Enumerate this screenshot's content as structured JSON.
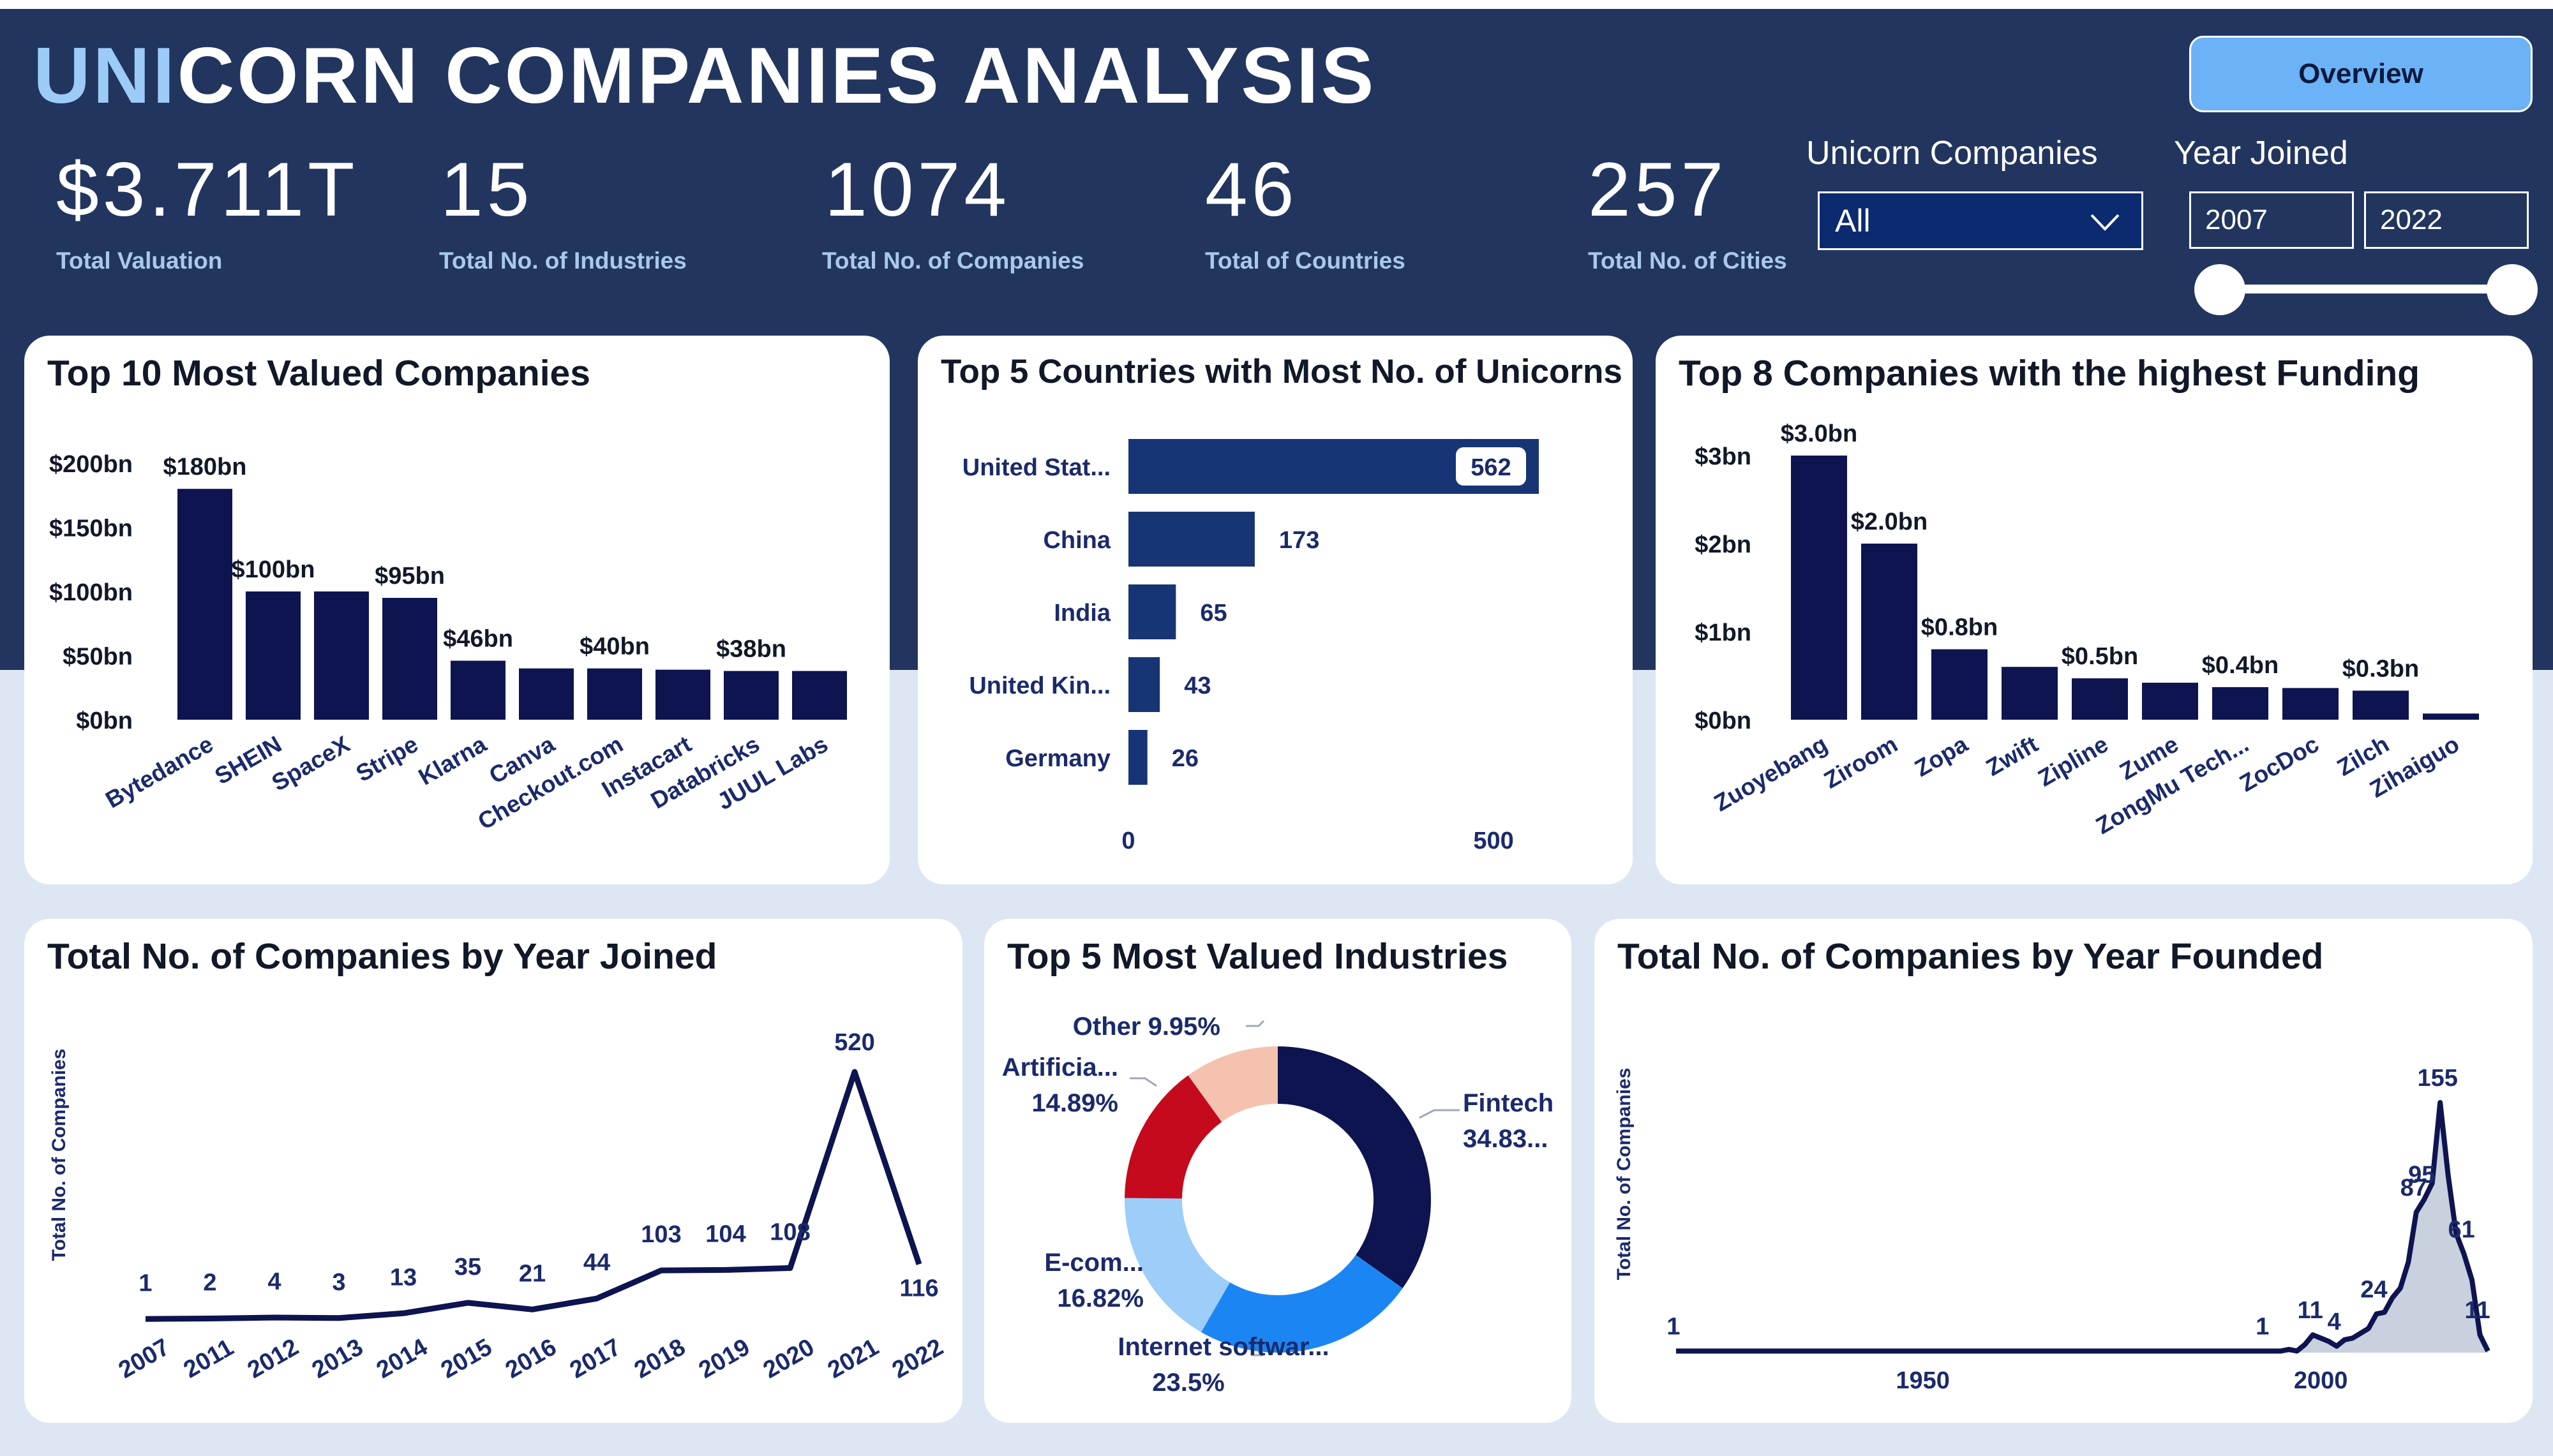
{
  "header": {
    "title_accent": "UNI",
    "title_rest": "CORN COMPANIES ANALYSIS",
    "overview_button": "Overview"
  },
  "kpis": [
    {
      "value": "$3.711T",
      "label": "Total Valuation"
    },
    {
      "value": "15",
      "label": "Total No. of Industries"
    },
    {
      "value": "1074",
      "label": "Total No. of Companies"
    },
    {
      "value": "46",
      "label": "Total of Countries"
    },
    {
      "value": "257",
      "label": "Total No. of Cities"
    }
  ],
  "filters": {
    "companies_title": "Unicorn Companies",
    "companies_selected": "All",
    "year_title": "Year Joined",
    "year_from": "2007",
    "year_to": "2022",
    "range_from_fraction": 0,
    "range_to_fraction": 1
  },
  "colors": {
    "header_bg": "#21355e",
    "page_bg": "#dce7f3",
    "navy": "#0d1450",
    "bar_blue": "#173574",
    "title_accent": "#9ccbf8",
    "button": "#6cb2f7"
  },
  "icons": [
    "chevron-down-icon"
  ],
  "chart_data": [
    {
      "id": "top_valued",
      "type": "bar",
      "title": "Top 10 Most Valued Companies",
      "categories": [
        "Bytedance",
        "SHEIN",
        "SpaceX",
        "Stripe",
        "Klarna",
        "Canva",
        "Checkout.com",
        "Instacart",
        "Databricks",
        "JUUL Labs"
      ],
      "values": [
        180,
        100,
        100,
        95,
        46,
        40,
        40,
        39,
        38,
        38
      ],
      "data_labels": [
        "$180bn",
        "$100bn",
        null,
        "$95bn",
        "$46bn",
        null,
        "$40bn",
        null,
        "$38bn",
        null
      ],
      "y_ticks": [
        "$0bn",
        "$50bn",
        "$100bn",
        "$150bn",
        "$200bn"
      ],
      "ylim": [
        0,
        200
      ],
      "color": "#0d1450"
    },
    {
      "id": "top_countries",
      "type": "bar",
      "orientation": "horizontal",
      "title": "Top 5 Countries with Most No. of Unicorns",
      "categories": [
        "United Stat...",
        "China",
        "India",
        "United Kin...",
        "Germany"
      ],
      "values": [
        562,
        173,
        65,
        43,
        26
      ],
      "data_labels": [
        "562",
        "173",
        "65",
        "43",
        "26"
      ],
      "x_ticks": [
        "0",
        "500"
      ],
      "xlim": [
        0,
        562
      ],
      "color": "#173574"
    },
    {
      "id": "top_funding",
      "type": "bar",
      "title": "Top 8 Companies with the highest Funding",
      "categories": [
        "Zuoyebang",
        "Ziroom",
        "Zopa",
        "Zwift",
        "Zipline",
        "Zume",
        "ZongMu Tech...",
        "ZocDoc",
        "Zilch",
        "Zihaiguo"
      ],
      "values": [
        3.0,
        2.0,
        0.8,
        0.6,
        0.47,
        0.42,
        0.37,
        0.36,
        0.33,
        0.07
      ],
      "data_labels": [
        "$3.0bn",
        "$2.0bn",
        "$0.8bn",
        null,
        "$0.5bn",
        null,
        "$0.4bn",
        null,
        "$0.3bn",
        null
      ],
      "y_ticks": [
        "$0bn",
        "$1bn",
        "$2bn",
        "$3bn"
      ],
      "ylim": [
        0,
        3.0
      ],
      "color": "#0d1450"
    },
    {
      "id": "year_joined",
      "type": "line",
      "title": "Total No. of Companies by Year Joined",
      "ylabel": "Total No. of Companies",
      "x": [
        "2007",
        "2011",
        "2012",
        "2013",
        "2014",
        "2015",
        "2016",
        "2017",
        "2018",
        "2019",
        "2020",
        "2021",
        "2022"
      ],
      "values": [
        1,
        2,
        4,
        3,
        13,
        35,
        21,
        44,
        103,
        104,
        108,
        520,
        116
      ],
      "data_labels": [
        "1",
        "2",
        "4",
        "3",
        "13",
        "35",
        "21",
        "44",
        "103",
        "104",
        "108",
        "520",
        "116"
      ],
      "ylim": [
        0,
        520
      ],
      "color": "#0d1450"
    },
    {
      "id": "industries",
      "type": "pie",
      "title": "Top 5 Most Valued Industries",
      "slices": [
        {
          "label": "Fintech",
          "pct_label": "34.83...",
          "value": 34.83,
          "color": "#0d1450"
        },
        {
          "label": "Internet softwar...",
          "pct_label": "23.5%",
          "value": 23.5,
          "color": "#1b86f3"
        },
        {
          "label": "E-com...",
          "pct_label": "16.82%",
          "value": 16.82,
          "color": "#9dcdf9"
        },
        {
          "label": "Artificia...",
          "pct_label": "14.89%",
          "value": 14.89,
          "color": "#c40a1c"
        },
        {
          "label": "Other",
          "pct_label": "9.95%",
          "value": 9.95,
          "color": "#f5c2b0"
        }
      ]
    },
    {
      "id": "year_founded",
      "type": "area",
      "title": "Total No. of Companies by Year Founded",
      "ylabel": "Total No. of Companies",
      "x": [
        1919,
        1960,
        1993,
        1994,
        1995,
        1996,
        1997,
        1998,
        1999,
        2000,
        2001,
        2002,
        2003,
        2004,
        2005,
        2006,
        2007,
        2008,
        2009,
        2010,
        2011,
        2012,
        2013,
        2014,
        2015,
        2016,
        2017,
        2018,
        2019,
        2020,
        2021
      ],
      "values": [
        1,
        1,
        1,
        1,
        1,
        2,
        1,
        5,
        11,
        9,
        7,
        4,
        8,
        9,
        12,
        15,
        24,
        25,
        34,
        40,
        56,
        87,
        95,
        105,
        155,
        110,
        74,
        61,
        45,
        11,
        1
      ],
      "labeled_points": [
        {
          "x": 1919,
          "label": "1"
        },
        {
          "x": 1993,
          "label": "1"
        },
        {
          "x": 1999,
          "label": "11"
        },
        {
          "x": 2002,
          "label": "4"
        },
        {
          "x": 2007,
          "label": "24"
        },
        {
          "x": 2012,
          "label": "87"
        },
        {
          "x": 2013,
          "label": "95"
        },
        {
          "x": 2015,
          "label": "155"
        },
        {
          "x": 2018,
          "label": "61"
        },
        {
          "x": 2020,
          "label": "11"
        }
      ],
      "x_ticks": [
        1950,
        2000
      ],
      "xlim": [
        1919,
        2021
      ],
      "ylim": [
        0,
        155
      ],
      "color": "#0d1450",
      "fill_color": "#c9d0de"
    }
  ]
}
